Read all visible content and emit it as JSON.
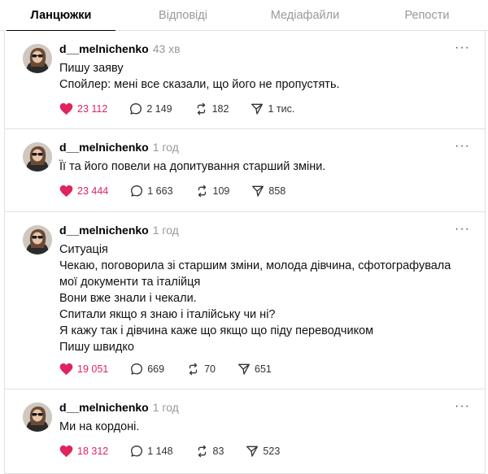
{
  "tabs": [
    {
      "label": "Ланцюжки",
      "active": true
    },
    {
      "label": "Відповіді",
      "active": false
    },
    {
      "label": "Медіафайли",
      "active": false
    },
    {
      "label": "Репости",
      "active": false
    }
  ],
  "posts": [
    {
      "username": "d__melnichenko",
      "time": "43 хв",
      "lines": [
        "Пишу заяву",
        "Спойлер: мені все сказали, що його не пропустять."
      ],
      "likes": "23 112",
      "comments": "2 149",
      "reposts": "182",
      "shares": "1 тис."
    },
    {
      "username": "d__melnichenko",
      "time": "1 год",
      "lines": [
        "Її та його повели на допитування старший зміни."
      ],
      "likes": "23 444",
      "comments": "1 663",
      "reposts": "109",
      "shares": "858"
    },
    {
      "username": "d__melnichenko",
      "time": "1 год",
      "lines": [
        "Ситуація",
        "Чекаю, поговорила зі старшим зміни, молода дівчина, сфотографувала мої документи та італійця",
        "Вони вже знали і чекали.",
        "Спитали якщо я знаю і італійську чи ні?",
        "Я кажу так і дівчина каже що якщо що піду переводчиком",
        "Пишу швидко"
      ],
      "likes": "19 051",
      "comments": "669",
      "reposts": "70",
      "shares": "651"
    },
    {
      "username": "d__melnichenko",
      "time": "1 год",
      "lines": [
        "Ми на кордоні."
      ],
      "likes": "18 312",
      "comments": "1 148",
      "reposts": "83",
      "shares": "523"
    }
  ],
  "icons": {
    "like": "heart-filled-icon",
    "comment": "comment-bubble-icon",
    "repost": "repost-arrows-icon",
    "share": "paper-plane-icon",
    "more": "more-horizontal-icon"
  },
  "colors": {
    "like": "#e0245e",
    "muted": "#999999",
    "border": "#e0e0e0"
  }
}
